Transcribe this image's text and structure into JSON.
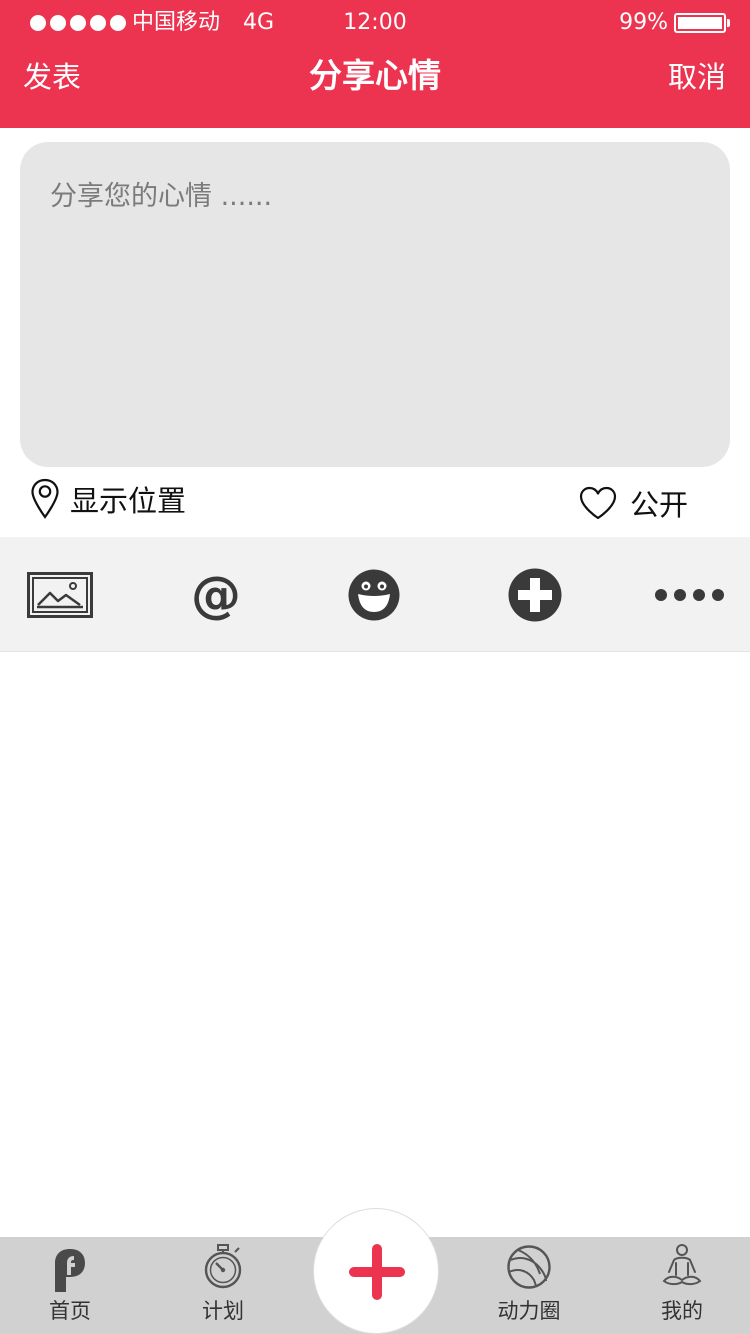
{
  "status_bar": {
    "carrier": "中国移动",
    "network": "4G",
    "time": "12:00",
    "battery": "99%",
    "battery_level": 0.99
  },
  "nav": {
    "left_label": "发表",
    "title": "分享心情",
    "right_label": "取消"
  },
  "composer": {
    "placeholder": "分享您的心情 ......",
    "value": ""
  },
  "options": {
    "location_label": "显示位置",
    "visibility_label": "公开"
  },
  "toolbar": {
    "icons": [
      "image-icon",
      "at-icon",
      "emoji-icon",
      "plus-circle-icon",
      "more-icon"
    ],
    "at_glyph": "@"
  },
  "tabbar": {
    "home_label": "首页",
    "plan_label": "计划",
    "circle_label": "动力圈",
    "me_label": "我的"
  },
  "colors": {
    "accent": "#ec3451",
    "input_bg": "#e6e6e6",
    "toolbar_bg": "#f2f2f2",
    "tabbar_bg": "#d1d1d1",
    "icon_dark": "#3a3a3a"
  }
}
